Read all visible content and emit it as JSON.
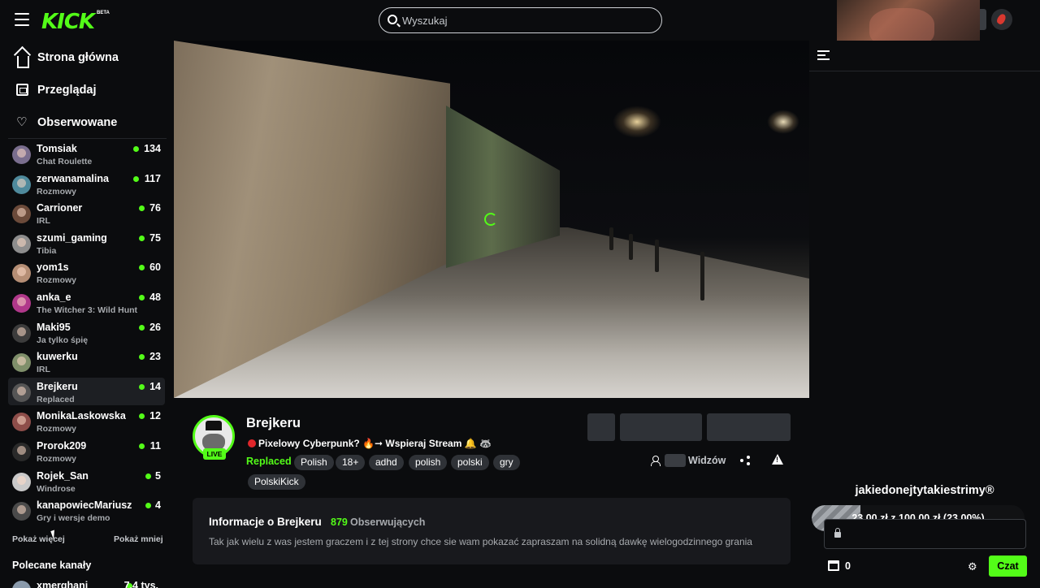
{
  "header": {
    "logo": "KICK",
    "logo_badge": "BETA",
    "search_placeholder": "Wyszukaj"
  },
  "nav": {
    "home": "Strona główna",
    "browse": "Przeglądaj",
    "following": "Obserwowane"
  },
  "followed_channels": [
    {
      "name": "Tomsiak",
      "category": "Chat Roulette",
      "viewers": "134",
      "avatar_color": "#7a6e8e"
    },
    {
      "name": "zerwanamalina",
      "category": "Rozmowy",
      "viewers": "117",
      "avatar_color": "#4f8a9c"
    },
    {
      "name": "Carrioner",
      "category": "IRL",
      "viewers": "76",
      "avatar_color": "#6b4a3a"
    },
    {
      "name": "szumi_gaming",
      "category": "Tibia",
      "viewers": "75",
      "avatar_color": "#8d8d8d"
    },
    {
      "name": "yom1s",
      "category": "Rozmowy",
      "viewers": "60",
      "avatar_color": "#b58e75"
    },
    {
      "name": "anka_e",
      "category": "The Witcher 3: Wild Hunt",
      "viewers": "48",
      "avatar_color": "#b0388a"
    },
    {
      "name": "Maki95",
      "category": "Ja tylko śpię",
      "viewers": "26",
      "avatar_color": "#3c3c3c"
    },
    {
      "name": "kuwerku",
      "category": "IRL",
      "viewers": "23",
      "avatar_color": "#7f8f6a"
    },
    {
      "name": "Brejkeru",
      "category": "Replaced",
      "viewers": "14",
      "avatar_color": "#555555"
    },
    {
      "name": "MonikaLaskowska",
      "category": "Rozmowy",
      "viewers": "12",
      "avatar_color": "#8e4e4a"
    },
    {
      "name": "Prorok209",
      "category": "Rozmowy",
      "viewers": "11",
      "avatar_color": "#2a2a2a"
    },
    {
      "name": "Rojek_San",
      "category": "Windrose",
      "viewers": "5",
      "avatar_color": "#c9c9c9"
    },
    {
      "name": "kanapowiecMariusz",
      "category": "Gry i wersje demo",
      "viewers": "4",
      "avatar_color": "#4a4a4a"
    }
  ],
  "sidebar": {
    "show_more": "Pokaż więcej",
    "show_less": "Pokaż mniej",
    "recommended_title": "Polecane kanały",
    "recommended_first": {
      "name": "xmerghani",
      "viewers": "7,4 tys."
    }
  },
  "stream": {
    "streamer": "Brejkeru",
    "live_label": "LIVE",
    "title": "Pixelowy Cyberpunk? 🔥➞ Wspieraj Stream 🔔 🦝",
    "category": "Replaced",
    "tags": [
      "Polish",
      "18+",
      "adhd",
      "polish",
      "polski",
      "gry",
      "PolskiKick"
    ],
    "viewers_label": "Widzów"
  },
  "about": {
    "title": "Informacje o Brejkeru",
    "followers": "879",
    "followers_label": "Obserwujących",
    "description": "Tak jak wielu z was jestem graczem i z tej strony chce sie wam pokazać zapraszam na solidną dawkę wielogodzinnego grania"
  },
  "chat": {
    "goal_title": "jakiedonejtytakiestrimy®",
    "goal_text": "23,00 zł z 100,00 zł (23.00%)",
    "goal_progress": 0.23,
    "points": "0",
    "chat_button": "Czat"
  },
  "colors": {
    "accent": "#53fc18",
    "background": "#0b0c0e",
    "card": "#18191d",
    "tag": "#2f3237"
  }
}
